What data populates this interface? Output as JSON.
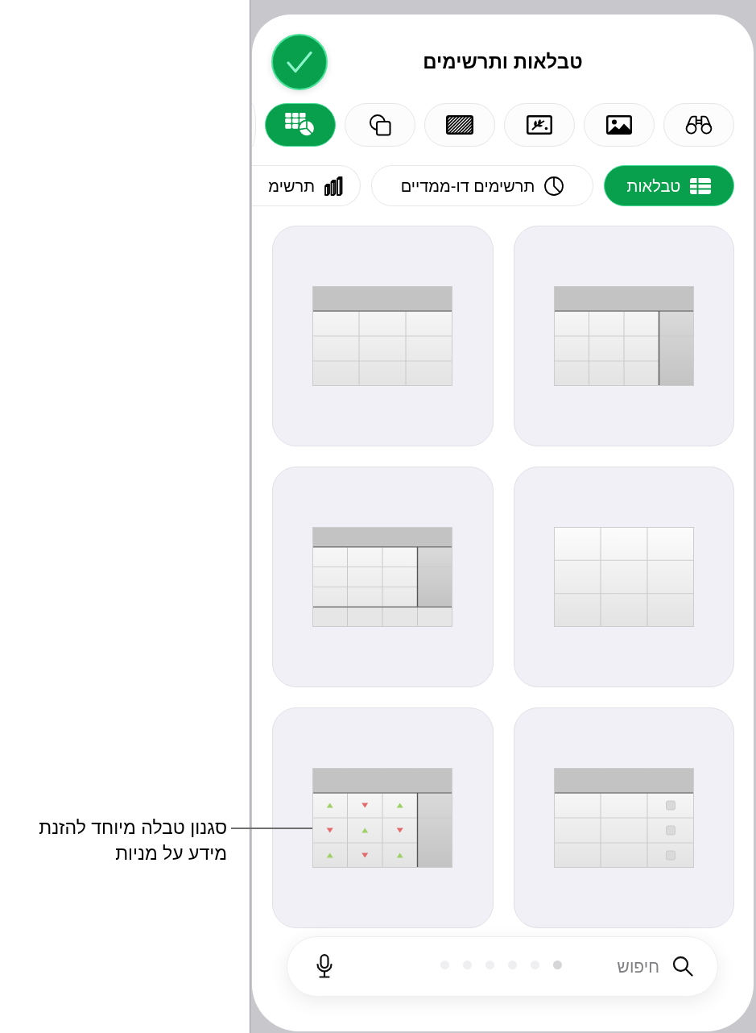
{
  "header": {
    "title": "טבלאות ותרשימים"
  },
  "categories": [
    {
      "kind": "binoculars",
      "selected": false
    },
    {
      "kind": "image",
      "selected": false
    },
    {
      "kind": "drawing",
      "selected": false
    },
    {
      "kind": "texture",
      "selected": false
    },
    {
      "kind": "shapes",
      "selected": false
    },
    {
      "kind": "tables_charts",
      "selected": true
    },
    {
      "kind": "cut_off",
      "selected": false
    }
  ],
  "tabs": [
    {
      "label": "טבלאות",
      "kind": "table",
      "selected": true
    },
    {
      "label": "תרשימים דו-ממדיים",
      "kind": "pie",
      "selected": false
    },
    {
      "label": "תרשימ",
      "kind": "bars",
      "selected": false
    }
  ],
  "table_styles": [
    {
      "kind": "plain",
      "header_row": true,
      "header_column": true,
      "footer_row": false
    },
    {
      "kind": "plain",
      "header_row": true,
      "header_column": false,
      "footer_row": false
    },
    {
      "kind": "plain",
      "header_row": false,
      "header_column": false,
      "footer_row": false
    },
    {
      "kind": "plain",
      "header_row": true,
      "header_column": true,
      "footer_row": true
    },
    {
      "kind": "checkboxes",
      "header_row": true,
      "header_column": false,
      "footer_row": false
    },
    {
      "kind": "stocks",
      "header_row": true,
      "header_column": true,
      "footer_row": false
    }
  ],
  "search": {
    "placeholder": "חיפוש"
  },
  "page_dots": [
    {
      "selected": true
    },
    {
      "selected": false
    },
    {
      "selected": false
    },
    {
      "selected": false
    },
    {
      "selected": false
    },
    {
      "selected": false
    }
  ],
  "callout": {
    "text": "סגנון טבלה מיוחד להזנת מידע על מניות"
  }
}
